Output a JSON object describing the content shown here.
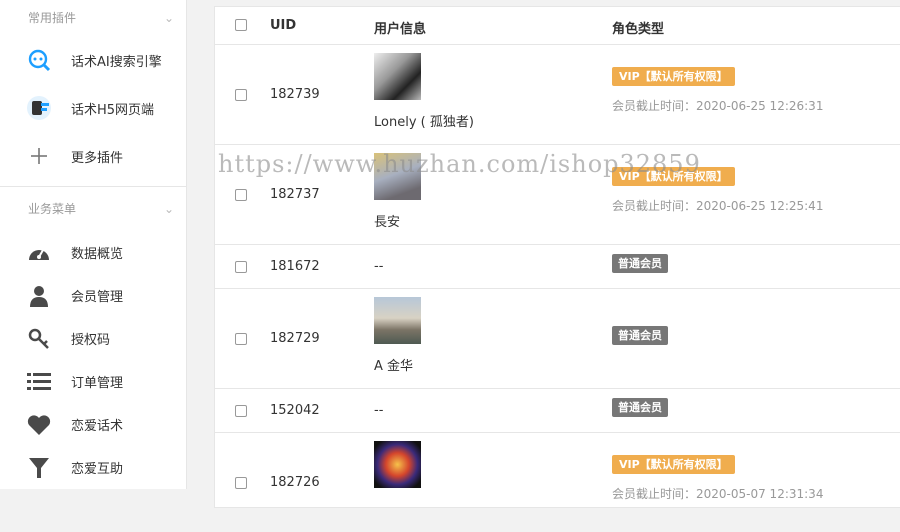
{
  "sidebar": {
    "group1_title": "常用插件",
    "group1_items": [
      {
        "label": "话术AI搜索引擎",
        "icon": "search-ai-icon"
      },
      {
        "label": "话术H5网页端",
        "icon": "h5-page-icon"
      },
      {
        "label": "更多插件",
        "icon": "plus-icon"
      }
    ],
    "group2_title": "业务菜单",
    "group2_items": [
      {
        "label": "数据概览",
        "icon": "dashboard-icon"
      },
      {
        "label": "会员管理",
        "icon": "user-icon"
      },
      {
        "label": "授权码",
        "icon": "key-icon"
      },
      {
        "label": "订单管理",
        "icon": "list-icon"
      },
      {
        "label": "恋爱话术",
        "icon": "heart-icon"
      },
      {
        "label": "恋爱互助",
        "icon": "funnel-icon"
      }
    ]
  },
  "table": {
    "headers": {
      "uid": "UID",
      "info": "用户信息",
      "role": "角色类型"
    },
    "rows": [
      {
        "uid": "182739",
        "name": "Lonely ( 孤独者)",
        "role": "VIP【默认所有权限】",
        "expire": "会员截止时间：2020-06-25 12:26:31"
      },
      {
        "uid": "182737",
        "name": "長安",
        "role": "VIP【默认所有权限】",
        "expire": "会员截止时间：2020-06-25 12:25:41"
      },
      {
        "uid": "181672",
        "name": "--",
        "role": "普通会员"
      },
      {
        "uid": "182729",
        "name": "A 金华",
        "role": "普通会员"
      },
      {
        "uid": "152042",
        "name": "--",
        "role": "普通会员"
      },
      {
        "uid": "182726",
        "role": "VIP【默认所有权限】",
        "expire": "会员截止时间：2020-05-07 12:31:34"
      }
    ]
  },
  "watermark": "https://www.huzhan.com/ishop32859",
  "colors": {
    "vip": "#f0ad4e",
    "normal": "#777777",
    "icon": "#4a4a4a",
    "accent": "#1e9fff"
  }
}
